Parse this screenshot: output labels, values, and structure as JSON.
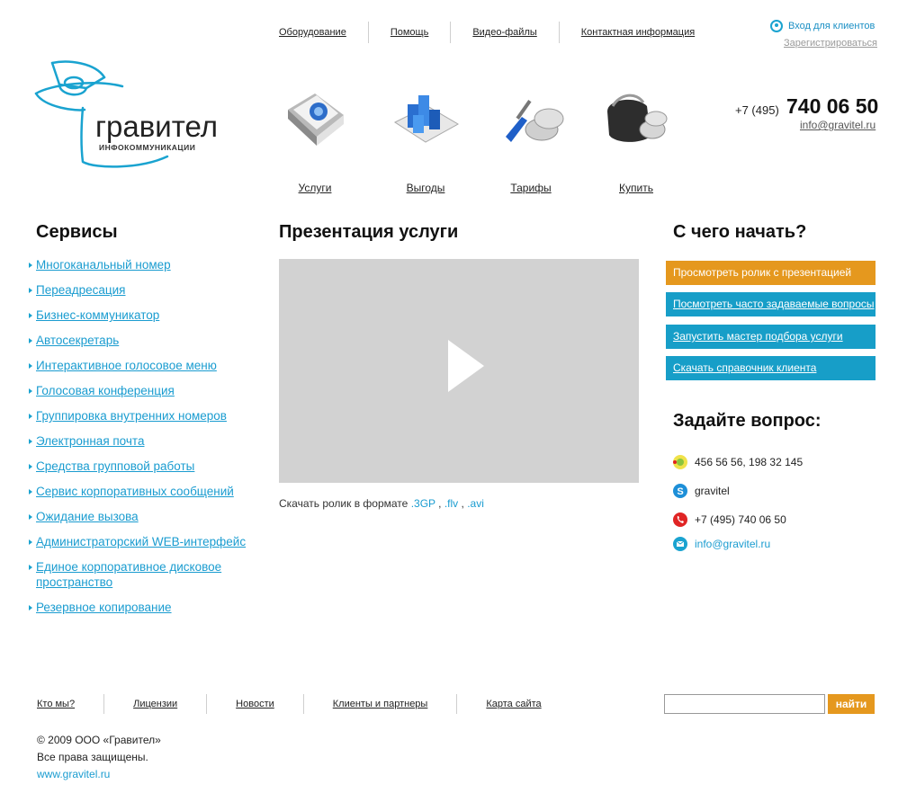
{
  "top_nav": [
    "Оборудование",
    "Помощь",
    "Видео-файлы",
    "Контактная информация"
  ],
  "login": {
    "label": "Вход для клиентов",
    "register": "Зарегистрироваться"
  },
  "logo": {
    "name": "гравител",
    "subtitle": "ИНФОКОММУНИКАЦИИ"
  },
  "products": [
    {
      "label": "Услуги",
      "icon": "book-icon"
    },
    {
      "label": "Выгоды",
      "icon": "bar-chart-icon"
    },
    {
      "label": "Тарифы",
      "icon": "screwdriver-coins-icon"
    },
    {
      "label": "Купить",
      "icon": "wallet-coins-icon"
    }
  ],
  "phone": {
    "prefix": "+7 (495)",
    "number": "740 06 50",
    "email": "info@gravitel.ru"
  },
  "services": {
    "title": "Сервисы",
    "items": [
      "Многоканальный номер",
      "Переадресация",
      "Бизнес-коммуникатор",
      "Автосекретарь",
      "Интерактивное голосовое меню",
      "Голосовая конференция",
      "Группировка внутренних номеров",
      "Электронная почта",
      "Средства групповой работы",
      "Сервис корпоративных сообщений",
      "Ожидание вызова",
      "Администраторский WEB-интерфейс",
      "Единое корпоративное дисковое пространство",
      "Резервное копирование"
    ]
  },
  "presentation": {
    "title": "Презентация услуги",
    "download_text": "Скачать ролик в формате",
    "formats": [
      ".3GP",
      ".flv",
      ".avi"
    ]
  },
  "start": {
    "title": "С чего начать?",
    "buttons": [
      "Просмотреть ролик с презентацией",
      "Посмотреть часто задаваемые вопросы",
      "Запустить мастер подбора услуги",
      "Скачать справочник клиента"
    ]
  },
  "ask": {
    "title": "Задайте вопрос:",
    "icq": "456 56 56, 198 32 145",
    "skype": "gravitel",
    "phone": "+7 (495) 740 06 50",
    "email": "info@gravitel.ru"
  },
  "footer": {
    "nav": [
      "Кто мы?",
      "Лицензии",
      "Новости",
      "Клиенты и партнеры",
      "Карта сайта"
    ],
    "search_button": "найти",
    "copyright": "© 2009 ООО «Гравител»",
    "rights": "Все права защищены.",
    "site": "www.gravitel.ru"
  },
  "colors": {
    "accent_blue": "#179ec8",
    "accent_orange": "#e5981e",
    "video_bg": "#d2d2d2"
  }
}
